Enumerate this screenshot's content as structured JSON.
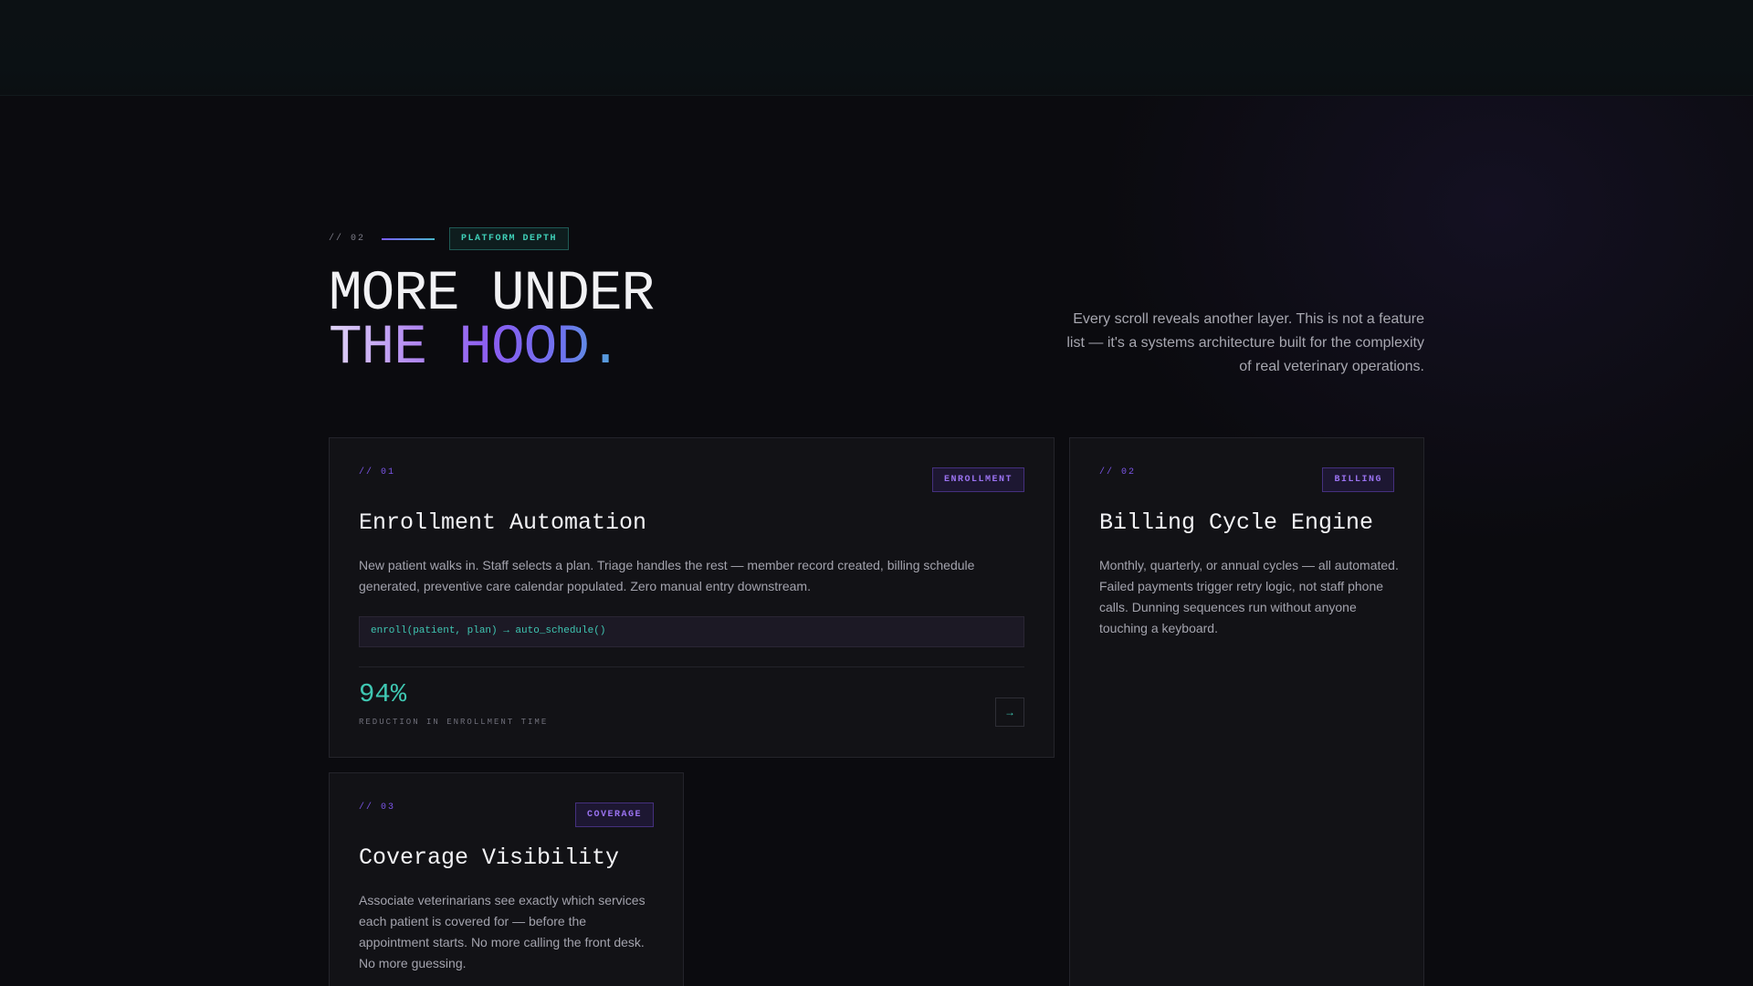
{
  "section": {
    "number": "// 02",
    "tag": "PLATFORM DEPTH",
    "headline_line1": "MORE UNDER",
    "headline_line2": "THE HOOD.",
    "intro": "Every scroll reveals another layer. This is not a feature list — it's a systems architecture built for the complexity of real veterinary operations."
  },
  "cards": [
    {
      "number": "// 01",
      "tag": "ENROLLMENT",
      "title": "Enrollment Automation",
      "description": "New patient walks in. Staff selects a plan. Triage handles the rest — member record created, billing schedule generated, preventive care calendar populated. Zero manual entry downstream.",
      "code": "enroll(patient, plan) → auto_schedule()",
      "stat_value": "94%",
      "stat_label": "REDUCTION IN ENROLLMENT TIME",
      "action": "→"
    },
    {
      "number": "// 02",
      "tag": "BILLING",
      "title": "Billing Cycle Engine",
      "description": "Monthly, quarterly, or annual cycles — all automated. Failed payments trigger retry logic, not staff phone calls. Dunning sequences run without anyone touching a keyboard."
    },
    {
      "number": "// 03",
      "tag": "COVERAGE",
      "title": "Coverage Visibility",
      "description": "Associate veterinarians see exactly which services each patient is covered for — before the appointment starts. No more calling the front desk. No more guessing."
    }
  ],
  "colors": {
    "background": "#0b0b0f",
    "accent_purple": "#7b55e8",
    "accent_teal": "#3fc7b2",
    "card": "#121216"
  }
}
